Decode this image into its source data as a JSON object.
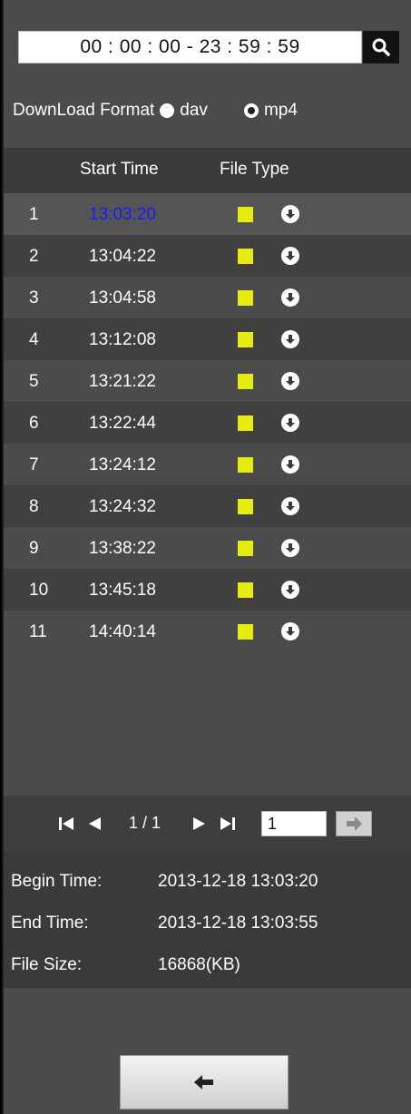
{
  "time_range": {
    "value": "00 : 00 : 00 - 23 : 59 : 59"
  },
  "download_format": {
    "label": "DownLoad Format",
    "options": [
      {
        "label": "dav",
        "checked": false
      },
      {
        "label": "mp4",
        "checked": true
      }
    ]
  },
  "table": {
    "headers": {
      "start_time": "Start Time",
      "file_type": "File Type"
    },
    "rows": [
      {
        "index": "1",
        "time": "13:03:20",
        "selected": true
      },
      {
        "index": "2",
        "time": "13:04:22"
      },
      {
        "index": "3",
        "time": "13:04:58"
      },
      {
        "index": "4",
        "time": "13:12:08"
      },
      {
        "index": "5",
        "time": "13:21:22"
      },
      {
        "index": "6",
        "time": "13:22:44"
      },
      {
        "index": "7",
        "time": "13:24:12"
      },
      {
        "index": "8",
        "time": "13:24:32"
      },
      {
        "index": "9",
        "time": "13:38:22"
      },
      {
        "index": "10",
        "time": "13:45:18"
      },
      {
        "index": "11",
        "time": "14:40:14"
      }
    ],
    "file_type_color": "#e6eb10",
    "selected_color": "#1a1aff"
  },
  "pager": {
    "page_text": "1 / 1",
    "page_input": "1",
    "icons": [
      "first-page-icon",
      "prev-page-icon",
      "next-page-icon",
      "last-page-icon",
      "go-arrow-icon"
    ]
  },
  "info": {
    "begin_label": "Begin Time:",
    "begin_value": "2013-12-18 13:03:20",
    "end_label": "End Time:",
    "end_value": "2013-12-18 13:03:55",
    "size_label": "File Size:",
    "size_value": "16868(KB)"
  },
  "back_button": {
    "icon": "back-arrow-icon"
  }
}
